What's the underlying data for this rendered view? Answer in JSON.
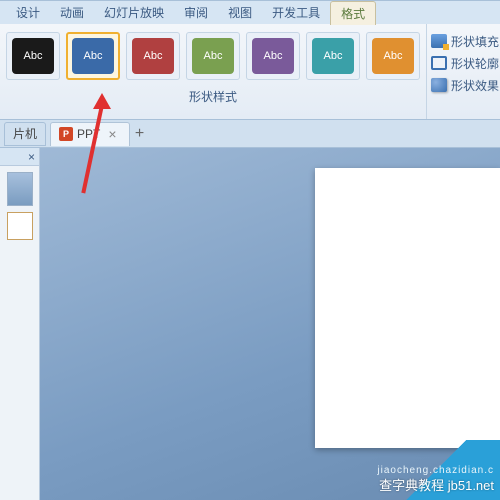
{
  "tabs": {
    "design": "设计",
    "anim": "动画",
    "slideshow": "幻灯片放映",
    "review": "审阅",
    "view": "视图",
    "devtools": "开发工具",
    "format": "格式"
  },
  "gallery": {
    "label_abc": "Abc",
    "group_label": "形状样式",
    "colors": {
      "c0": "#1a1a1a",
      "c1": "#3a6aa8",
      "c2": "#b04040",
      "c3": "#7aa050",
      "c4": "#7a5a9a",
      "c5": "#3aa0a8",
      "c6": "#e09030"
    }
  },
  "fmt": {
    "fill": "形状填充",
    "outline": "形状轮廓",
    "effects": "形状效果"
  },
  "doctabs": {
    "first": "片机",
    "ppt_label": "PPT",
    "ppt_icon": "P",
    "close": "×",
    "add": "+"
  },
  "thumb": {
    "close": "×"
  },
  "watermark": {
    "sub": "jiaocheng.chazidian.c",
    "main": "查字典教程 jb51.net"
  }
}
